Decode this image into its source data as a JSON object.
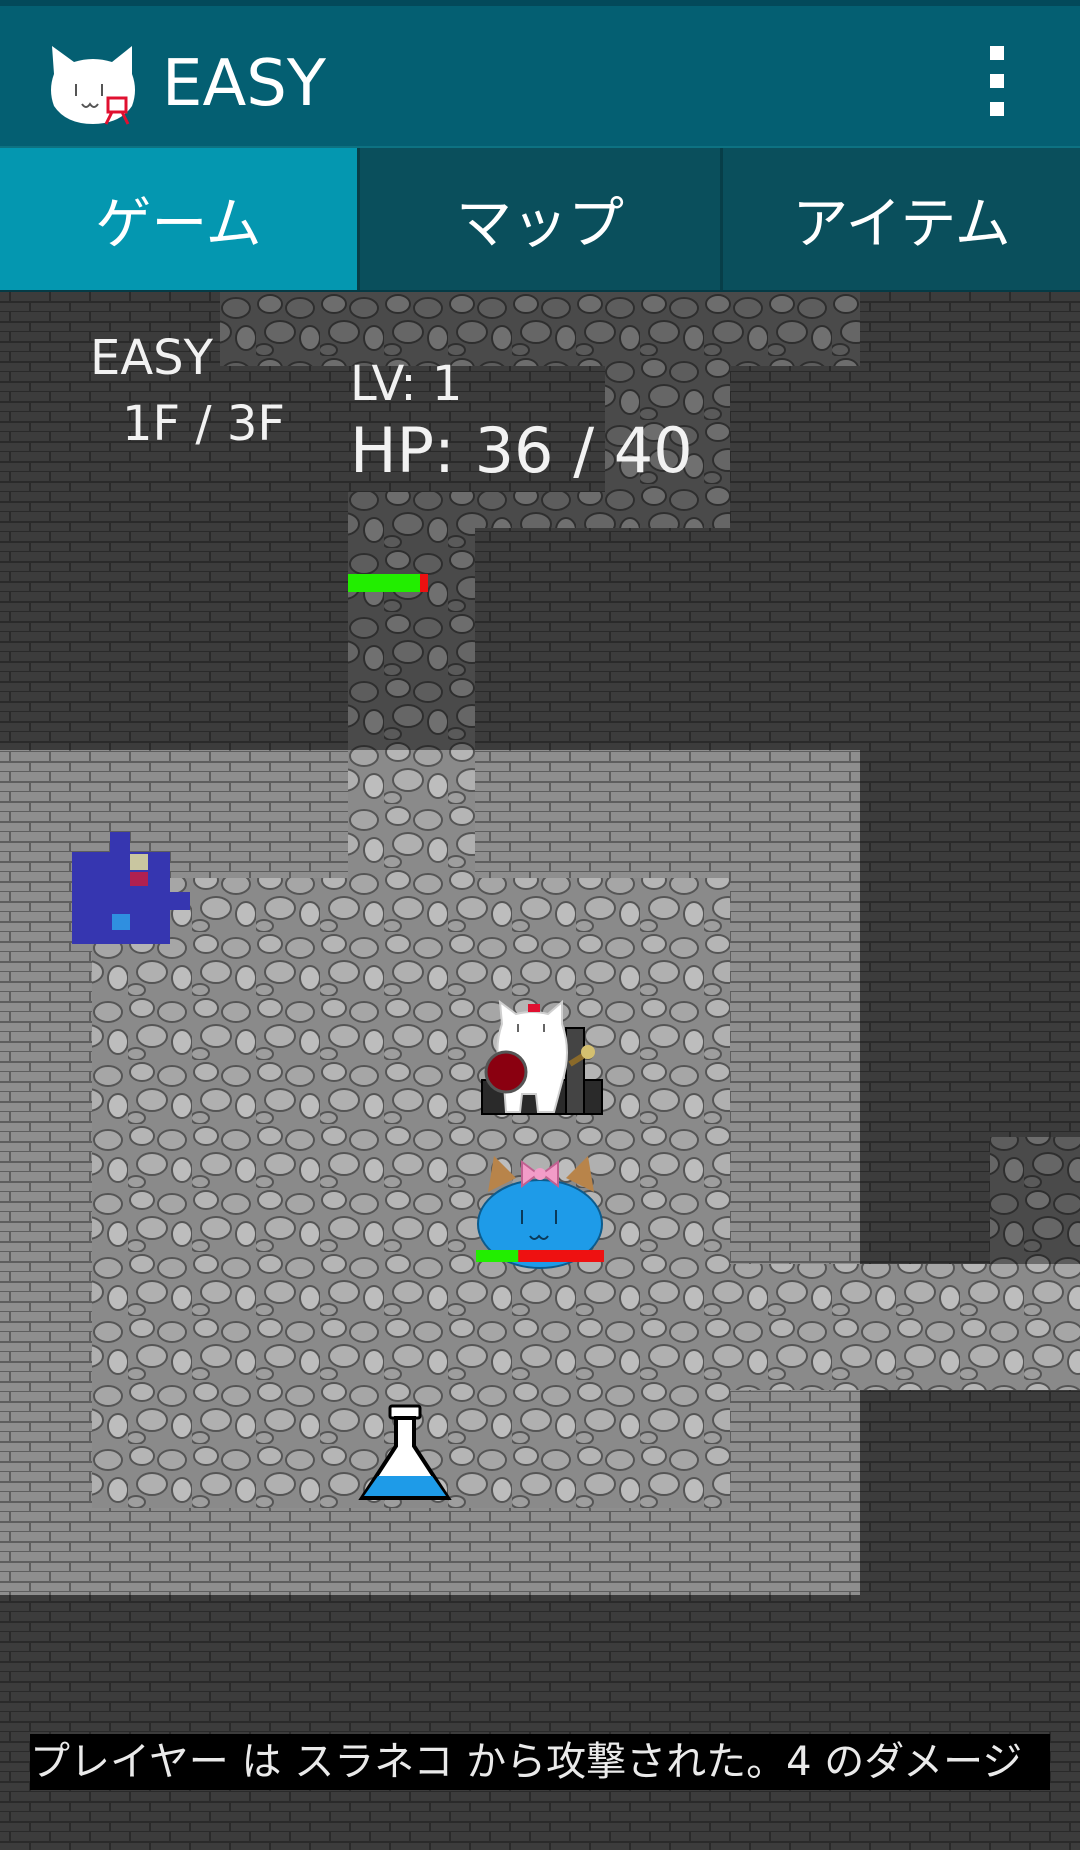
{
  "app": {
    "title": "EASY",
    "logo_icon": "cat-face-logo-icon",
    "menu_icon": "overflow-menu-icon"
  },
  "tabs": [
    {
      "label": "ゲーム",
      "active": true
    },
    {
      "label": "マップ",
      "active": false
    },
    {
      "label": "アイテム",
      "active": false
    }
  ],
  "hud": {
    "difficulty": "EASY",
    "floor": "1F / 3F",
    "level": "LV: 1",
    "hp": "HP: 36 / 40",
    "hp_fraction": 0.9
  },
  "board": {
    "player_icon": "cat-knight-icon",
    "enemy_icon": "slime-cat-enemy-icon",
    "enemy_hp_fraction": 0.33,
    "item_icon": "potion-flask-icon",
    "minimap_icon": "minimap-icon"
  },
  "message": "プレイヤー は スラネコ から攻撃された。4 のダメージ",
  "colors": {
    "appbar": "#045f72",
    "tab_active": "#0497b0",
    "tab_inactive": "#0a4f5c",
    "hp_green": "#22ee00",
    "hp_red": "#ee1111",
    "slime_blue": "#1e9be8"
  }
}
